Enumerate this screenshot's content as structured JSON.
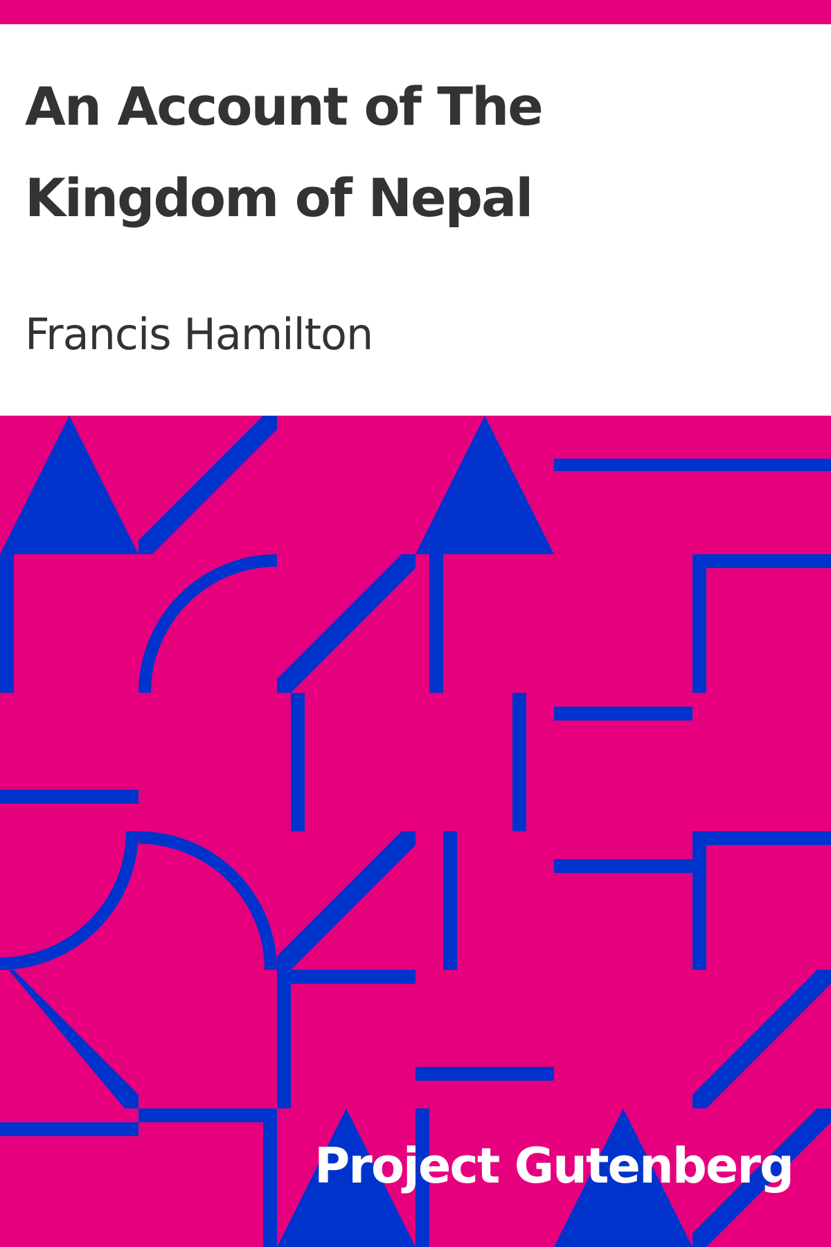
{
  "cover": {
    "title": "An Account of The Kingdom of Nepal",
    "author": "Francis Hamilton",
    "publisher": "Project Gutenberg"
  },
  "colors": {
    "background_accent": "#e6007e",
    "pattern": "#0033cc",
    "title_text": "#333333",
    "publisher_text": "#ffffff"
  }
}
